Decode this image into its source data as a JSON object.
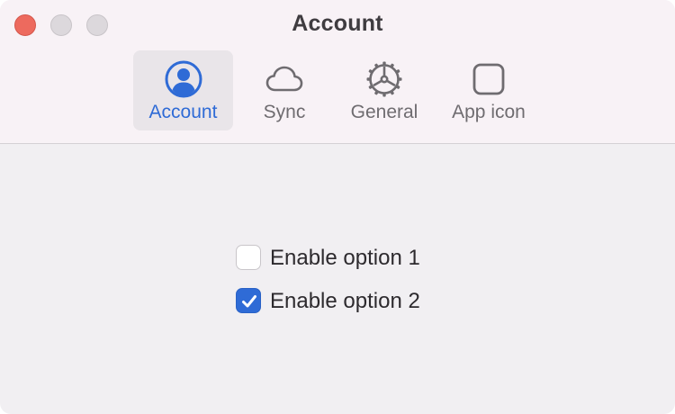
{
  "window": {
    "title": "Account"
  },
  "toolbar": {
    "tabs": [
      {
        "label": "Account",
        "icon": "person-circle-icon",
        "selected": true
      },
      {
        "label": "Sync",
        "icon": "cloud-icon",
        "selected": false
      },
      {
        "label": "General",
        "icon": "gear-icon",
        "selected": false
      },
      {
        "label": "App icon",
        "icon": "square-icon",
        "selected": false
      }
    ]
  },
  "options": [
    {
      "label": "Enable option 1",
      "checked": false
    },
    {
      "label": "Enable option 2",
      "checked": true
    }
  ],
  "colors": {
    "accent": "#2f6bd6",
    "close_button": "#ed6a5e",
    "inactive_button": "#dcd8dc",
    "titlebar_bg": "#f8f2f6",
    "content_bg": "#f1eff2"
  }
}
